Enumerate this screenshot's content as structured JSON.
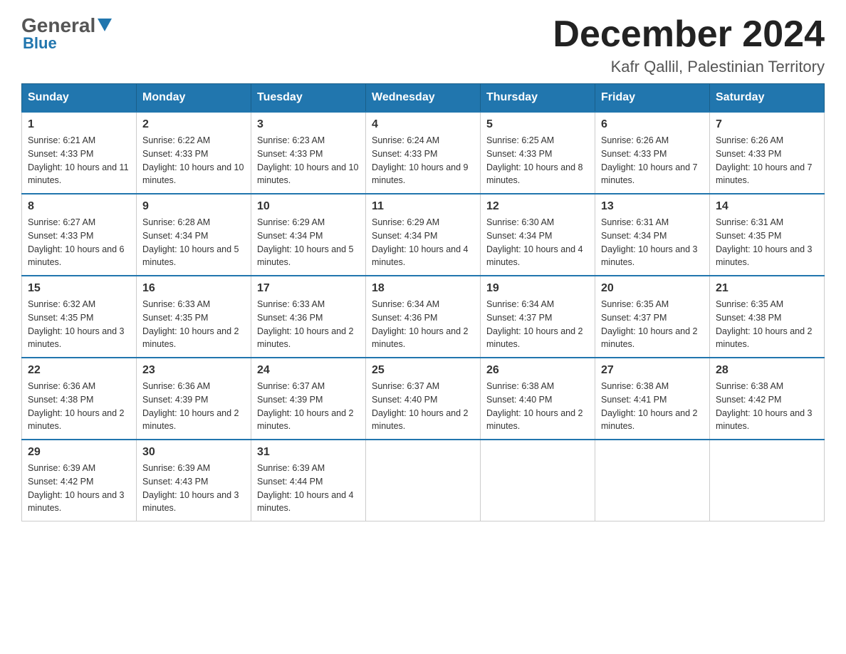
{
  "logo": {
    "general": "General",
    "blue": "Blue"
  },
  "title": {
    "month_year": "December 2024",
    "location": "Kafr Qallil, Palestinian Territory"
  },
  "weekdays": [
    "Sunday",
    "Monday",
    "Tuesday",
    "Wednesday",
    "Thursday",
    "Friday",
    "Saturday"
  ],
  "weeks": [
    [
      {
        "day": "1",
        "sunrise": "6:21 AM",
        "sunset": "4:33 PM",
        "daylight": "10 hours and 11 minutes."
      },
      {
        "day": "2",
        "sunrise": "6:22 AM",
        "sunset": "4:33 PM",
        "daylight": "10 hours and 10 minutes."
      },
      {
        "day": "3",
        "sunrise": "6:23 AM",
        "sunset": "4:33 PM",
        "daylight": "10 hours and 10 minutes."
      },
      {
        "day": "4",
        "sunrise": "6:24 AM",
        "sunset": "4:33 PM",
        "daylight": "10 hours and 9 minutes."
      },
      {
        "day": "5",
        "sunrise": "6:25 AM",
        "sunset": "4:33 PM",
        "daylight": "10 hours and 8 minutes."
      },
      {
        "day": "6",
        "sunrise": "6:26 AM",
        "sunset": "4:33 PM",
        "daylight": "10 hours and 7 minutes."
      },
      {
        "day": "7",
        "sunrise": "6:26 AM",
        "sunset": "4:33 PM",
        "daylight": "10 hours and 7 minutes."
      }
    ],
    [
      {
        "day": "8",
        "sunrise": "6:27 AM",
        "sunset": "4:33 PM",
        "daylight": "10 hours and 6 minutes."
      },
      {
        "day": "9",
        "sunrise": "6:28 AM",
        "sunset": "4:34 PM",
        "daylight": "10 hours and 5 minutes."
      },
      {
        "day": "10",
        "sunrise": "6:29 AM",
        "sunset": "4:34 PM",
        "daylight": "10 hours and 5 minutes."
      },
      {
        "day": "11",
        "sunrise": "6:29 AM",
        "sunset": "4:34 PM",
        "daylight": "10 hours and 4 minutes."
      },
      {
        "day": "12",
        "sunrise": "6:30 AM",
        "sunset": "4:34 PM",
        "daylight": "10 hours and 4 minutes."
      },
      {
        "day": "13",
        "sunrise": "6:31 AM",
        "sunset": "4:34 PM",
        "daylight": "10 hours and 3 minutes."
      },
      {
        "day": "14",
        "sunrise": "6:31 AM",
        "sunset": "4:35 PM",
        "daylight": "10 hours and 3 minutes."
      }
    ],
    [
      {
        "day": "15",
        "sunrise": "6:32 AM",
        "sunset": "4:35 PM",
        "daylight": "10 hours and 3 minutes."
      },
      {
        "day": "16",
        "sunrise": "6:33 AM",
        "sunset": "4:35 PM",
        "daylight": "10 hours and 2 minutes."
      },
      {
        "day": "17",
        "sunrise": "6:33 AM",
        "sunset": "4:36 PM",
        "daylight": "10 hours and 2 minutes."
      },
      {
        "day": "18",
        "sunrise": "6:34 AM",
        "sunset": "4:36 PM",
        "daylight": "10 hours and 2 minutes."
      },
      {
        "day": "19",
        "sunrise": "6:34 AM",
        "sunset": "4:37 PM",
        "daylight": "10 hours and 2 minutes."
      },
      {
        "day": "20",
        "sunrise": "6:35 AM",
        "sunset": "4:37 PM",
        "daylight": "10 hours and 2 minutes."
      },
      {
        "day": "21",
        "sunrise": "6:35 AM",
        "sunset": "4:38 PM",
        "daylight": "10 hours and 2 minutes."
      }
    ],
    [
      {
        "day": "22",
        "sunrise": "6:36 AM",
        "sunset": "4:38 PM",
        "daylight": "10 hours and 2 minutes."
      },
      {
        "day": "23",
        "sunrise": "6:36 AM",
        "sunset": "4:39 PM",
        "daylight": "10 hours and 2 minutes."
      },
      {
        "day": "24",
        "sunrise": "6:37 AM",
        "sunset": "4:39 PM",
        "daylight": "10 hours and 2 minutes."
      },
      {
        "day": "25",
        "sunrise": "6:37 AM",
        "sunset": "4:40 PM",
        "daylight": "10 hours and 2 minutes."
      },
      {
        "day": "26",
        "sunrise": "6:38 AM",
        "sunset": "4:40 PM",
        "daylight": "10 hours and 2 minutes."
      },
      {
        "day": "27",
        "sunrise": "6:38 AM",
        "sunset": "4:41 PM",
        "daylight": "10 hours and 2 minutes."
      },
      {
        "day": "28",
        "sunrise": "6:38 AM",
        "sunset": "4:42 PM",
        "daylight": "10 hours and 3 minutes."
      }
    ],
    [
      {
        "day": "29",
        "sunrise": "6:39 AM",
        "sunset": "4:42 PM",
        "daylight": "10 hours and 3 minutes."
      },
      {
        "day": "30",
        "sunrise": "6:39 AM",
        "sunset": "4:43 PM",
        "daylight": "10 hours and 3 minutes."
      },
      {
        "day": "31",
        "sunrise": "6:39 AM",
        "sunset": "4:44 PM",
        "daylight": "10 hours and 4 minutes."
      },
      null,
      null,
      null,
      null
    ]
  ],
  "labels": {
    "sunrise": "Sunrise:",
    "sunset": "Sunset:",
    "daylight": "Daylight:"
  }
}
